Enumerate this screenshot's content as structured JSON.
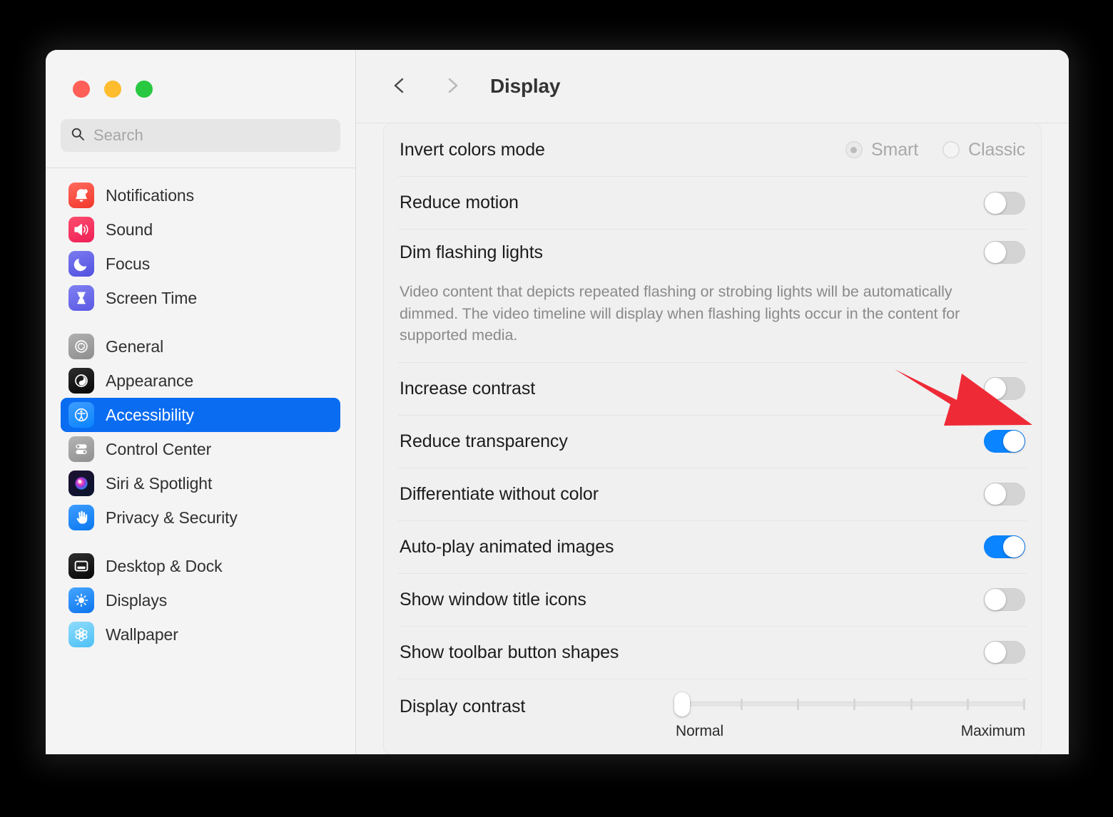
{
  "window": {
    "traffic_lights": [
      "close",
      "minimize",
      "zoom"
    ],
    "colors": {
      "red": "#ff5f57",
      "yellow": "#febc2e",
      "green": "#28c840",
      "accent": "#0a84ff",
      "selected": "#0a6cf1",
      "arrow": "#ef2a37"
    }
  },
  "search": {
    "placeholder": "Search",
    "value": ""
  },
  "sidebar": {
    "groups": [
      {
        "items": [
          {
            "label": "Notifications",
            "icon": "bell-icon",
            "selected": false
          },
          {
            "label": "Sound",
            "icon": "speaker-icon",
            "selected": false
          },
          {
            "label": "Focus",
            "icon": "moon-icon",
            "selected": false
          },
          {
            "label": "Screen Time",
            "icon": "hourglass-icon",
            "selected": false
          }
        ]
      },
      {
        "items": [
          {
            "label": "General",
            "icon": "gear-icon",
            "selected": false
          },
          {
            "label": "Appearance",
            "icon": "appearance-icon",
            "selected": false
          },
          {
            "label": "Accessibility",
            "icon": "accessibility-icon",
            "selected": true
          },
          {
            "label": "Control Center",
            "icon": "control-center-icon",
            "selected": false
          },
          {
            "label": "Siri & Spotlight",
            "icon": "siri-icon",
            "selected": false
          },
          {
            "label": "Privacy & Security",
            "icon": "hand-icon",
            "selected": false
          }
        ]
      },
      {
        "items": [
          {
            "label": "Desktop & Dock",
            "icon": "desktop-dock-icon",
            "selected": false
          },
          {
            "label": "Displays",
            "icon": "brightness-icon",
            "selected": false
          },
          {
            "label": "Wallpaper",
            "icon": "wallpaper-icon",
            "selected": false
          }
        ]
      }
    ]
  },
  "toolbar": {
    "back_icon": "chevron-left-icon",
    "forward_icon": "chevron-right-icon",
    "title": "Display"
  },
  "settings": {
    "rows": [
      {
        "label": "Invert colors mode",
        "control": "radio",
        "options": [
          {
            "label": "Smart",
            "selected": true,
            "disabled": true
          },
          {
            "label": "Classic",
            "selected": false,
            "disabled": true
          }
        ]
      },
      {
        "label": "Reduce motion",
        "control": "toggle",
        "value": false
      },
      {
        "label": "Dim flashing lights",
        "control": "toggle",
        "value": false,
        "description": "Video content that depicts repeated flashing or strobing lights will be automatically dimmed. The video timeline will display when flashing lights occur in the content for supported media."
      },
      {
        "label": "Increase contrast",
        "control": "toggle",
        "value": false
      },
      {
        "label": "Reduce transparency",
        "control": "toggle",
        "value": true,
        "highlighted": true
      },
      {
        "label": "Differentiate without color",
        "control": "toggle",
        "value": false
      },
      {
        "label": "Auto-play animated images",
        "control": "toggle",
        "value": true
      },
      {
        "label": "Show window title icons",
        "control": "toggle",
        "value": false
      },
      {
        "label": "Show toolbar button shapes",
        "control": "toggle",
        "value": false
      },
      {
        "label": "Display contrast",
        "control": "slider",
        "min_label": "Normal",
        "max_label": "Maximum",
        "value": 0,
        "ticks": 7
      }
    ]
  },
  "annotation": {
    "type": "arrow",
    "color": "#ef2a37",
    "points_to": "reduce-transparency-toggle"
  }
}
